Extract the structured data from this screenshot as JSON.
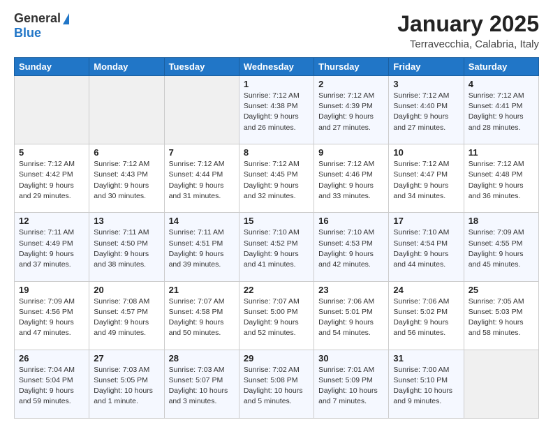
{
  "header": {
    "logo_line1": "General",
    "logo_line2": "Blue",
    "month": "January 2025",
    "location": "Terravecchia, Calabria, Italy"
  },
  "weekdays": [
    "Sunday",
    "Monday",
    "Tuesday",
    "Wednesday",
    "Thursday",
    "Friday",
    "Saturday"
  ],
  "weeks": [
    [
      {
        "day": "",
        "info": ""
      },
      {
        "day": "",
        "info": ""
      },
      {
        "day": "",
        "info": ""
      },
      {
        "day": "1",
        "info": "Sunrise: 7:12 AM\nSunset: 4:38 PM\nDaylight: 9 hours and 26 minutes."
      },
      {
        "day": "2",
        "info": "Sunrise: 7:12 AM\nSunset: 4:39 PM\nDaylight: 9 hours and 27 minutes."
      },
      {
        "day": "3",
        "info": "Sunrise: 7:12 AM\nSunset: 4:40 PM\nDaylight: 9 hours and 27 minutes."
      },
      {
        "day": "4",
        "info": "Sunrise: 7:12 AM\nSunset: 4:41 PM\nDaylight: 9 hours and 28 minutes."
      }
    ],
    [
      {
        "day": "5",
        "info": "Sunrise: 7:12 AM\nSunset: 4:42 PM\nDaylight: 9 hours and 29 minutes."
      },
      {
        "day": "6",
        "info": "Sunrise: 7:12 AM\nSunset: 4:43 PM\nDaylight: 9 hours and 30 minutes."
      },
      {
        "day": "7",
        "info": "Sunrise: 7:12 AM\nSunset: 4:44 PM\nDaylight: 9 hours and 31 minutes."
      },
      {
        "day": "8",
        "info": "Sunrise: 7:12 AM\nSunset: 4:45 PM\nDaylight: 9 hours and 32 minutes."
      },
      {
        "day": "9",
        "info": "Sunrise: 7:12 AM\nSunset: 4:46 PM\nDaylight: 9 hours and 33 minutes."
      },
      {
        "day": "10",
        "info": "Sunrise: 7:12 AM\nSunset: 4:47 PM\nDaylight: 9 hours and 34 minutes."
      },
      {
        "day": "11",
        "info": "Sunrise: 7:12 AM\nSunset: 4:48 PM\nDaylight: 9 hours and 36 minutes."
      }
    ],
    [
      {
        "day": "12",
        "info": "Sunrise: 7:11 AM\nSunset: 4:49 PM\nDaylight: 9 hours and 37 minutes."
      },
      {
        "day": "13",
        "info": "Sunrise: 7:11 AM\nSunset: 4:50 PM\nDaylight: 9 hours and 38 minutes."
      },
      {
        "day": "14",
        "info": "Sunrise: 7:11 AM\nSunset: 4:51 PM\nDaylight: 9 hours and 39 minutes."
      },
      {
        "day": "15",
        "info": "Sunrise: 7:10 AM\nSunset: 4:52 PM\nDaylight: 9 hours and 41 minutes."
      },
      {
        "day": "16",
        "info": "Sunrise: 7:10 AM\nSunset: 4:53 PM\nDaylight: 9 hours and 42 minutes."
      },
      {
        "day": "17",
        "info": "Sunrise: 7:10 AM\nSunset: 4:54 PM\nDaylight: 9 hours and 44 minutes."
      },
      {
        "day": "18",
        "info": "Sunrise: 7:09 AM\nSunset: 4:55 PM\nDaylight: 9 hours and 45 minutes."
      }
    ],
    [
      {
        "day": "19",
        "info": "Sunrise: 7:09 AM\nSunset: 4:56 PM\nDaylight: 9 hours and 47 minutes."
      },
      {
        "day": "20",
        "info": "Sunrise: 7:08 AM\nSunset: 4:57 PM\nDaylight: 9 hours and 49 minutes."
      },
      {
        "day": "21",
        "info": "Sunrise: 7:07 AM\nSunset: 4:58 PM\nDaylight: 9 hours and 50 minutes."
      },
      {
        "day": "22",
        "info": "Sunrise: 7:07 AM\nSunset: 5:00 PM\nDaylight: 9 hours and 52 minutes."
      },
      {
        "day": "23",
        "info": "Sunrise: 7:06 AM\nSunset: 5:01 PM\nDaylight: 9 hours and 54 minutes."
      },
      {
        "day": "24",
        "info": "Sunrise: 7:06 AM\nSunset: 5:02 PM\nDaylight: 9 hours and 56 minutes."
      },
      {
        "day": "25",
        "info": "Sunrise: 7:05 AM\nSunset: 5:03 PM\nDaylight: 9 hours and 58 minutes."
      }
    ],
    [
      {
        "day": "26",
        "info": "Sunrise: 7:04 AM\nSunset: 5:04 PM\nDaylight: 9 hours and 59 minutes."
      },
      {
        "day": "27",
        "info": "Sunrise: 7:03 AM\nSunset: 5:05 PM\nDaylight: 10 hours and 1 minute."
      },
      {
        "day": "28",
        "info": "Sunrise: 7:03 AM\nSunset: 5:07 PM\nDaylight: 10 hours and 3 minutes."
      },
      {
        "day": "29",
        "info": "Sunrise: 7:02 AM\nSunset: 5:08 PM\nDaylight: 10 hours and 5 minutes."
      },
      {
        "day": "30",
        "info": "Sunrise: 7:01 AM\nSunset: 5:09 PM\nDaylight: 10 hours and 7 minutes."
      },
      {
        "day": "31",
        "info": "Sunrise: 7:00 AM\nSunset: 5:10 PM\nDaylight: 10 hours and 9 minutes."
      },
      {
        "day": "",
        "info": ""
      }
    ]
  ]
}
